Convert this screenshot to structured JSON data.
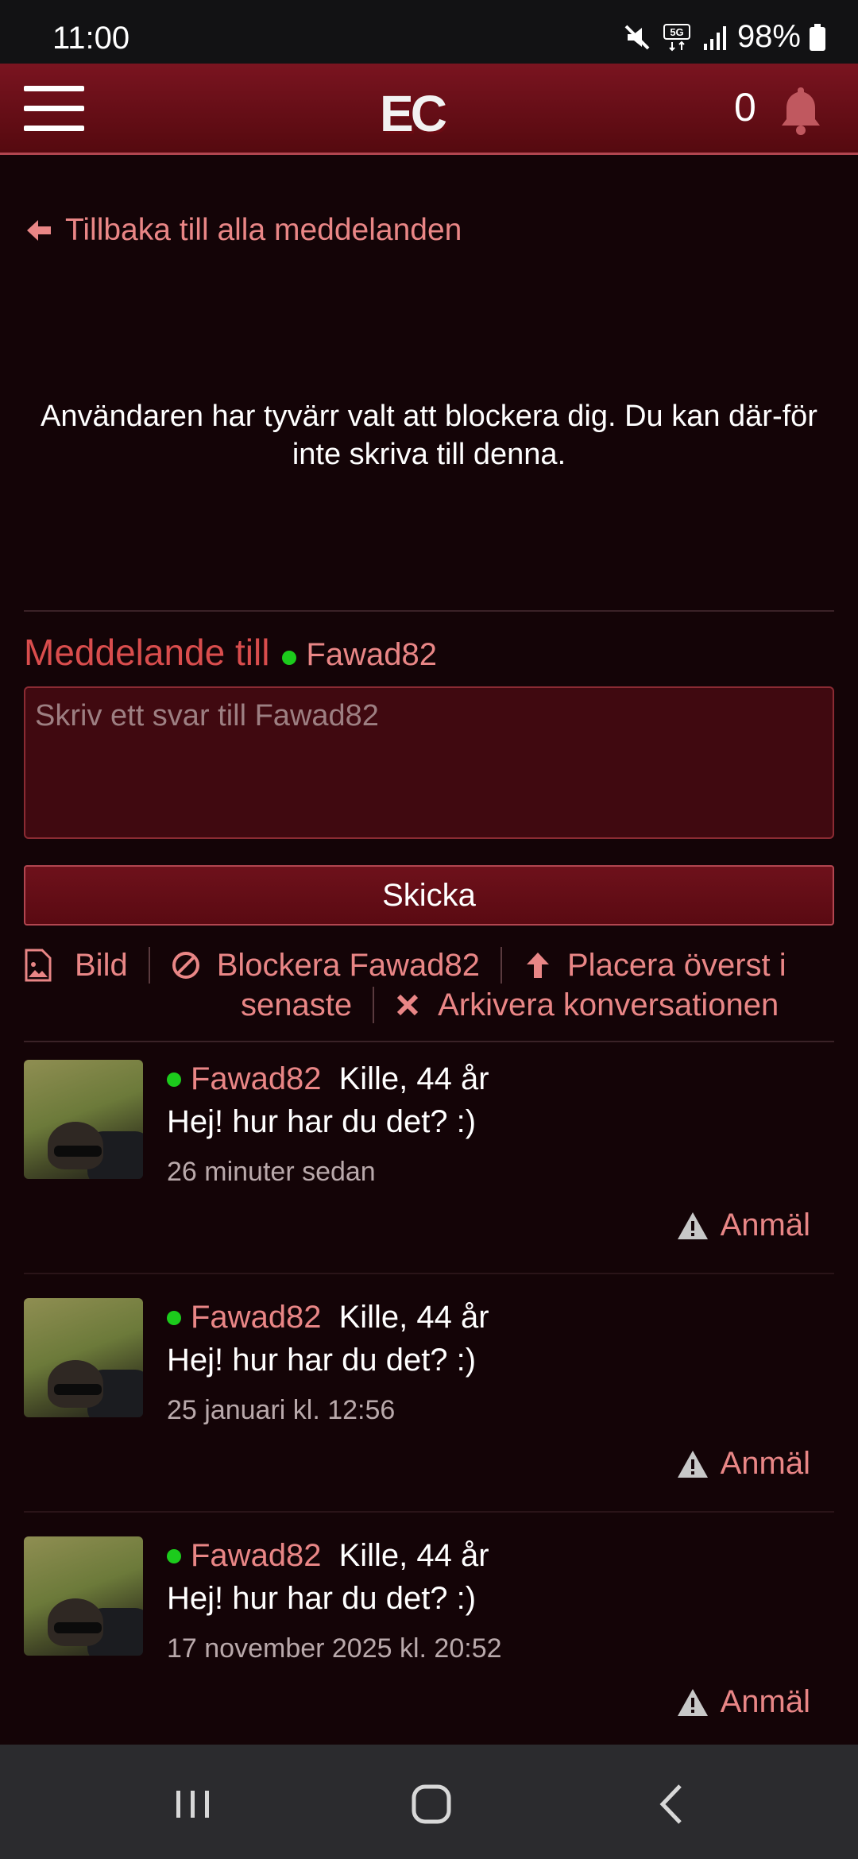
{
  "status_bar": {
    "time": "11:00",
    "battery": "98%",
    "network": "5G"
  },
  "header": {
    "logo": "EC",
    "notification_count": "0"
  },
  "back_link": "Tillbaka till alla meddelanden",
  "blocked_notice": "Användaren har tyvärr valt att blockera dig. Du kan där-för inte skriva till denna.",
  "compose": {
    "title": "Meddelande till",
    "recipient": "Fawad82",
    "placeholder": "Skriv ett svar till Fawad82",
    "send_label": "Skicka"
  },
  "actions": {
    "image": "Bild",
    "block": "Blockera Fawad82",
    "pin_line1": "Placera överst i",
    "pin_line2": "senaste",
    "archive": "Arkivera konversationen"
  },
  "messages": [
    {
      "user": "Fawad82",
      "info": "Kille, 44 år",
      "text": "Hej! hur har du det? :)",
      "time": "26 minuter sedan",
      "report": "Anmäl"
    },
    {
      "user": "Fawad82",
      "info": "Kille, 44 år",
      "text": "Hej! hur har du det? :)",
      "time": "25 januari kl. 12:56",
      "report": "Anmäl"
    },
    {
      "user": "Fawad82",
      "info": "Kille, 44 år",
      "text": "Hej! hur har du det? :)",
      "time": "17 november 2025 kl. 20:52",
      "report": "Anmäl"
    }
  ],
  "colors": {
    "accent": "#e98686",
    "header": "#6e111b",
    "background": "#140407",
    "online": "#1ccb1c"
  }
}
